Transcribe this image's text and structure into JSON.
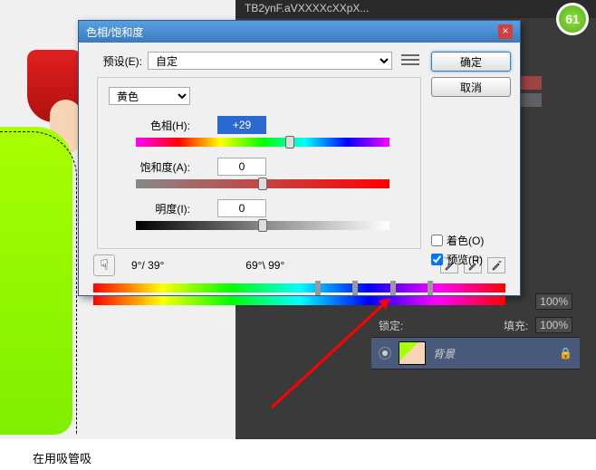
{
  "tab": {
    "filename": "TB2ynF.aVXXXXcXXpX..."
  },
  "badge": {
    "text": "61"
  },
  "dialog": {
    "title": "色相/饱和度",
    "preset_label": "预设(E):",
    "preset_value": "自定",
    "ok": "确定",
    "cancel": "取消",
    "channel": "黄色",
    "hue_label": "色相(H):",
    "hue_value": "+29",
    "sat_label": "饱和度(A):",
    "sat_value": "0",
    "lig_label": "明度(I):",
    "lig_value": "0",
    "angle_left": "9°/ 39°",
    "angle_right": "69°\\ 99°",
    "colorize_label": "着色(O)",
    "preview_label": "预览(P)"
  },
  "layers": {
    "lock_label": "锁定:",
    "fill_label": "填充:",
    "fill_value": "100%",
    "opacity_value": "100%",
    "bg_layer": "背景",
    "lock_icon": "🔒"
  },
  "caption": "在用吸管吸"
}
